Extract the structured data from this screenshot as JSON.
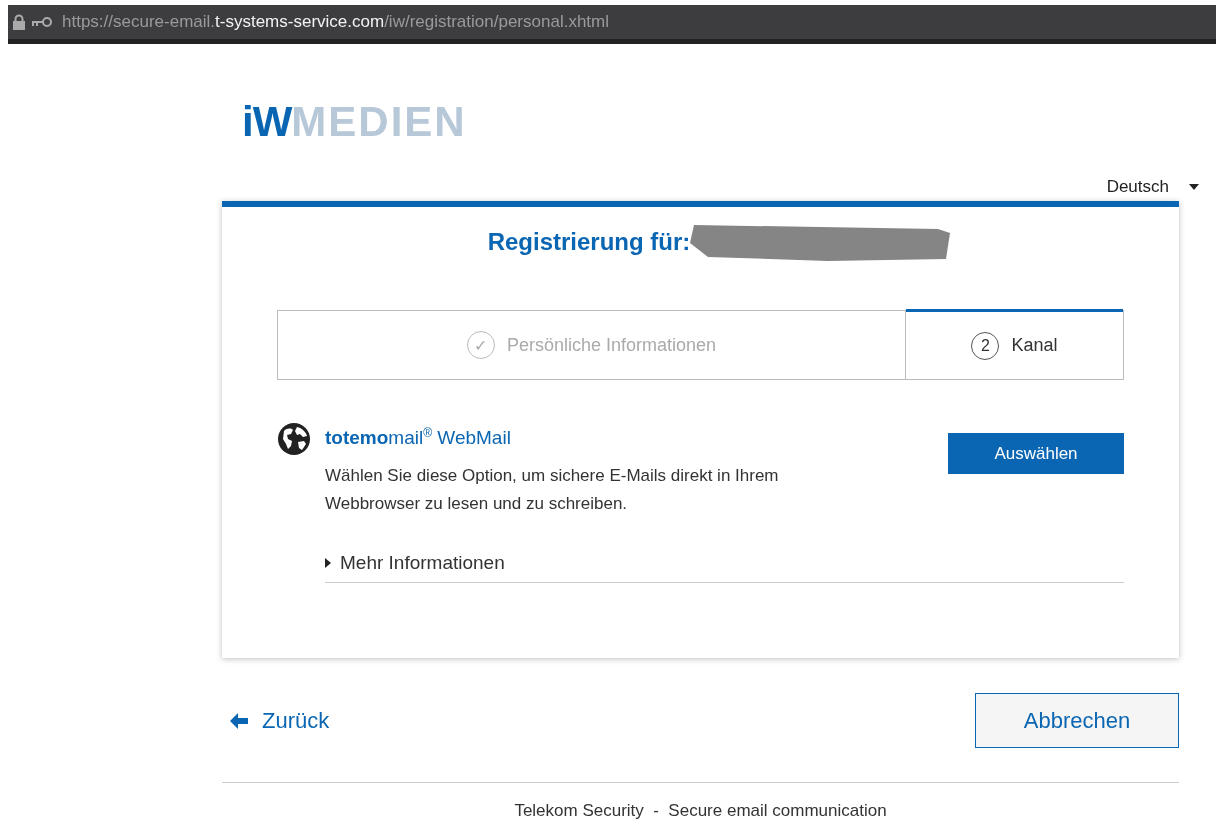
{
  "address_bar": {
    "url_parts": [
      {
        "text": "https://secure-email.",
        "emphasis": false
      },
      {
        "text": "t-systems-service.com",
        "emphasis": true
      },
      {
        "text": "/iw/registration/personal.xhtml",
        "emphasis": false
      }
    ]
  },
  "logo": {
    "parts": [
      {
        "text": "iW",
        "kind": "strong"
      },
      {
        "text": "MEDIEN",
        "kind": "light"
      }
    ]
  },
  "language": {
    "value": "Deutsch"
  },
  "card": {
    "title": "Registrierung für:",
    "steps": [
      {
        "marker": "✓",
        "label": "Persönliche Informationen",
        "selected": false,
        "done": true
      },
      {
        "marker": "2",
        "label": "Kanal",
        "selected": true,
        "done": false
      }
    ],
    "option": {
      "title": "**totemo**mail$^{®}$ WebMail",
      "button": "Auswählen",
      "description": "Wählen Sie diese Option, um sichere E-Mails direkt in Ihrem Webbrowser zu lesen und zu schreiben.",
      "more": {
        "label": "Mehr Informationen",
        "expanded": false
      }
    }
  },
  "back_link": "Zurück",
  "cancel_button": "Abbrechen",
  "footer": "Telekom Security  -  Secure email communication"
}
